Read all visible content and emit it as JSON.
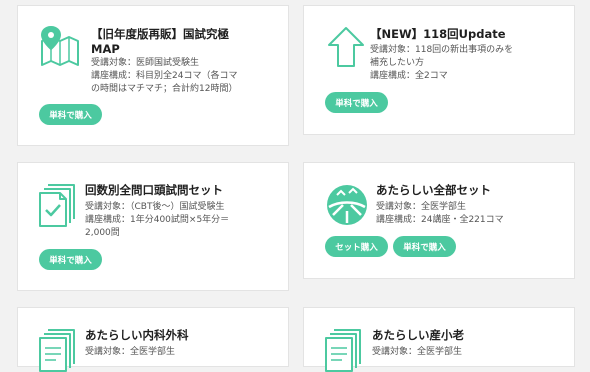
{
  "courses": [
    {
      "title_line1": "【旧年度版再販】国試究極",
      "title_line2": "MAP",
      "meta_lines": [
        "受講対象：医師国試受験生",
        "講座構成：科目別全24コマ（各コマ",
        "の時間はマチマチ；合計約12時間）"
      ],
      "buttons": [
        "単科で購入"
      ],
      "icon": "map-pin-icon"
    },
    {
      "title_line1": "【NEW】118回Update",
      "meta_lines": [
        "受講対象：118回の新出事項のみを",
        "補充したい方",
        "講座構成：全2コマ"
      ],
      "buttons": [
        "単科で購入"
      ],
      "icon": "up-arrow-icon"
    },
    {
      "title_line1": "回数別全問口頭試問セット",
      "meta_lines": [
        "受講対象：（CBT後〜）国試受験生",
        "講座構成：1年分400試問×5年分＝",
        "2,000問"
      ],
      "buttons": [
        "単科で購入"
      ],
      "icon": "document-check-icon"
    },
    {
      "title_line1": "あたらしい全部セット",
      "meta_lines": [
        "受講対象：全医学部生",
        "講座構成：24講座・全221コマ"
      ],
      "buttons": [
        "セット購入",
        "単科で購入"
      ],
      "icon": "road-badge-icon"
    },
    {
      "title_line1": "あたらしい内科外科",
      "meta_lines": [
        "受講対象：全医学部生"
      ],
      "buttons": [],
      "icon": "document-stack-icon"
    },
    {
      "title_line1": "あたらしい産小老",
      "meta_lines": [
        "受講対象：全医学部生"
      ],
      "buttons": [],
      "icon": "document-stack-icon"
    }
  ],
  "colors": {
    "accent": "#4cc9a0",
    "background": "#f2f2f2"
  }
}
